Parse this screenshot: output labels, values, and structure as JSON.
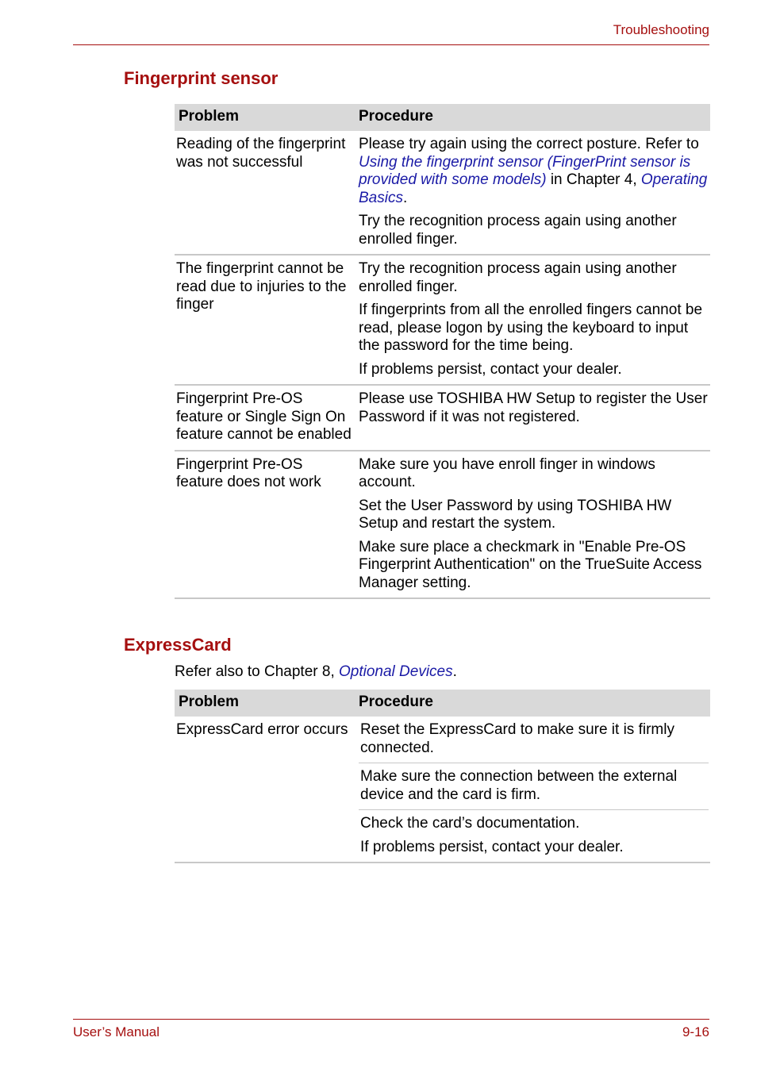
{
  "header": {
    "running_title": "Troubleshooting"
  },
  "footer": {
    "manual": "User’s Manual",
    "page_number": "9-16"
  },
  "fingerprint": {
    "title": "Fingerprint sensor",
    "columns": [
      "Problem",
      "Procedure"
    ],
    "rows": [
      {
        "problem": "Reading of the fingerprint was not successful",
        "p1_a": "Please try again using the correct posture. Refer to ",
        "p1_link1": "Using the fingerprint sensor (FingerPrint sensor is provided with some models)",
        "p1_b": " in Chapter 4, ",
        "p1_link2": "Operating Basics",
        "p1_c": ".",
        "p2": "Try the recognition process again using another enrolled finger."
      },
      {
        "problem": "The fingerprint cannot be read due to injuries to the finger",
        "procedures": [
          "Try the recognition process again using another enrolled finger.",
          "If fingerprints from all the enrolled fingers cannot be read, please logon by using the keyboard to input the password for the time being.",
          "If problems persist, contact your dealer."
        ]
      },
      {
        "problem": "Fingerprint Pre-OS feature or Single Sign On feature cannot be enabled",
        "procedures": [
          "Please use TOSHIBA HW Setup to register the User Password if it was not registered."
        ]
      },
      {
        "problem": "Fingerprint Pre-OS feature does not work",
        "procedures": [
          "Make sure you have enroll finger in windows account.",
          "Set the User Password by using TOSHIBA HW Setup and restart the system.",
          "Make sure place a checkmark in \"Enable Pre-OS Fingerprint Authentication\" on the TrueSuite Access Manager setting."
        ]
      }
    ]
  },
  "expresscard": {
    "title": "ExpressCard",
    "intro_prefix": "Refer also to Chapter 8, ",
    "intro_link": "Optional Devices",
    "intro_suffix": ".",
    "columns": [
      "Problem",
      "Procedure"
    ],
    "rows": [
      {
        "problem": "ExpressCard error occurs",
        "procedure_blocks": [
          [
            "Reset the ExpressCard to make sure it is firmly connected."
          ],
          [
            "Make sure the connection between the external device and the card is firm."
          ],
          [
            "Check the card’s documentation.",
            "If problems persist, contact your dealer."
          ]
        ]
      }
    ]
  },
  "colors": {
    "accent": "#a50f0f",
    "link": "#1a1aa6",
    "table_header_bg": "#d9d9d9",
    "rule": "#c8c8c8"
  }
}
